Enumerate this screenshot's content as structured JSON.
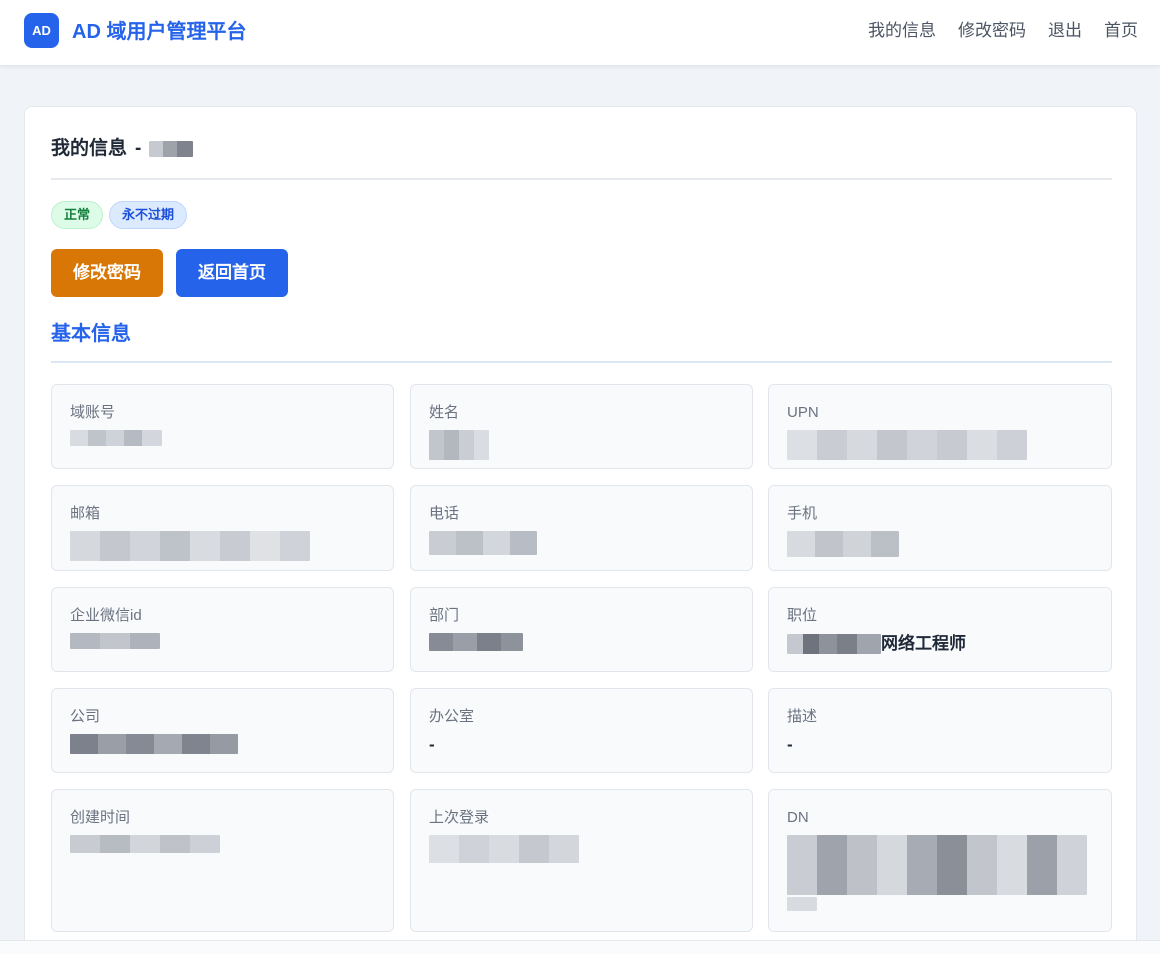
{
  "header": {
    "logo_text": "AD",
    "brand": "AD 域用户管理平台",
    "nav": [
      {
        "label": "我的信息"
      },
      {
        "label": "修改密码"
      },
      {
        "label": "退出"
      },
      {
        "label": "首页"
      }
    ]
  },
  "profile": {
    "title": "我的信息",
    "separator": "-",
    "status_badges": [
      {
        "label": "正常",
        "color": "#15803d"
      },
      {
        "label": "永不过期",
        "color": "#1d4ed8"
      }
    ],
    "actions": {
      "change_password": "修改密码",
      "back_home": "返回首页"
    },
    "section_title": "基本信息",
    "fields": [
      {
        "label": "域账号",
        "value": ""
      },
      {
        "label": "姓名",
        "value": ""
      },
      {
        "label": "UPN",
        "value": ""
      },
      {
        "label": "邮箱",
        "value": ""
      },
      {
        "label": "电话",
        "value": ""
      },
      {
        "label": "手机",
        "value": ""
      },
      {
        "label": "企业微信id",
        "value": ""
      },
      {
        "label": "部门",
        "value": ""
      },
      {
        "label": "职位",
        "value": "网络工程师"
      },
      {
        "label": "公司",
        "value": ""
      },
      {
        "label": "办公室",
        "value": "-"
      },
      {
        "label": "描述",
        "value": "-"
      },
      {
        "label": "创建时间",
        "value": ""
      },
      {
        "label": "上次登录",
        "value": ""
      },
      {
        "label": "DN",
        "value": ""
      }
    ]
  },
  "colors": {
    "primary": "#2563eb",
    "warning": "#d97706",
    "success_bg": "#dcfce7",
    "info_bg": "#dbeafe",
    "page_bg": "#f0f3f7"
  }
}
